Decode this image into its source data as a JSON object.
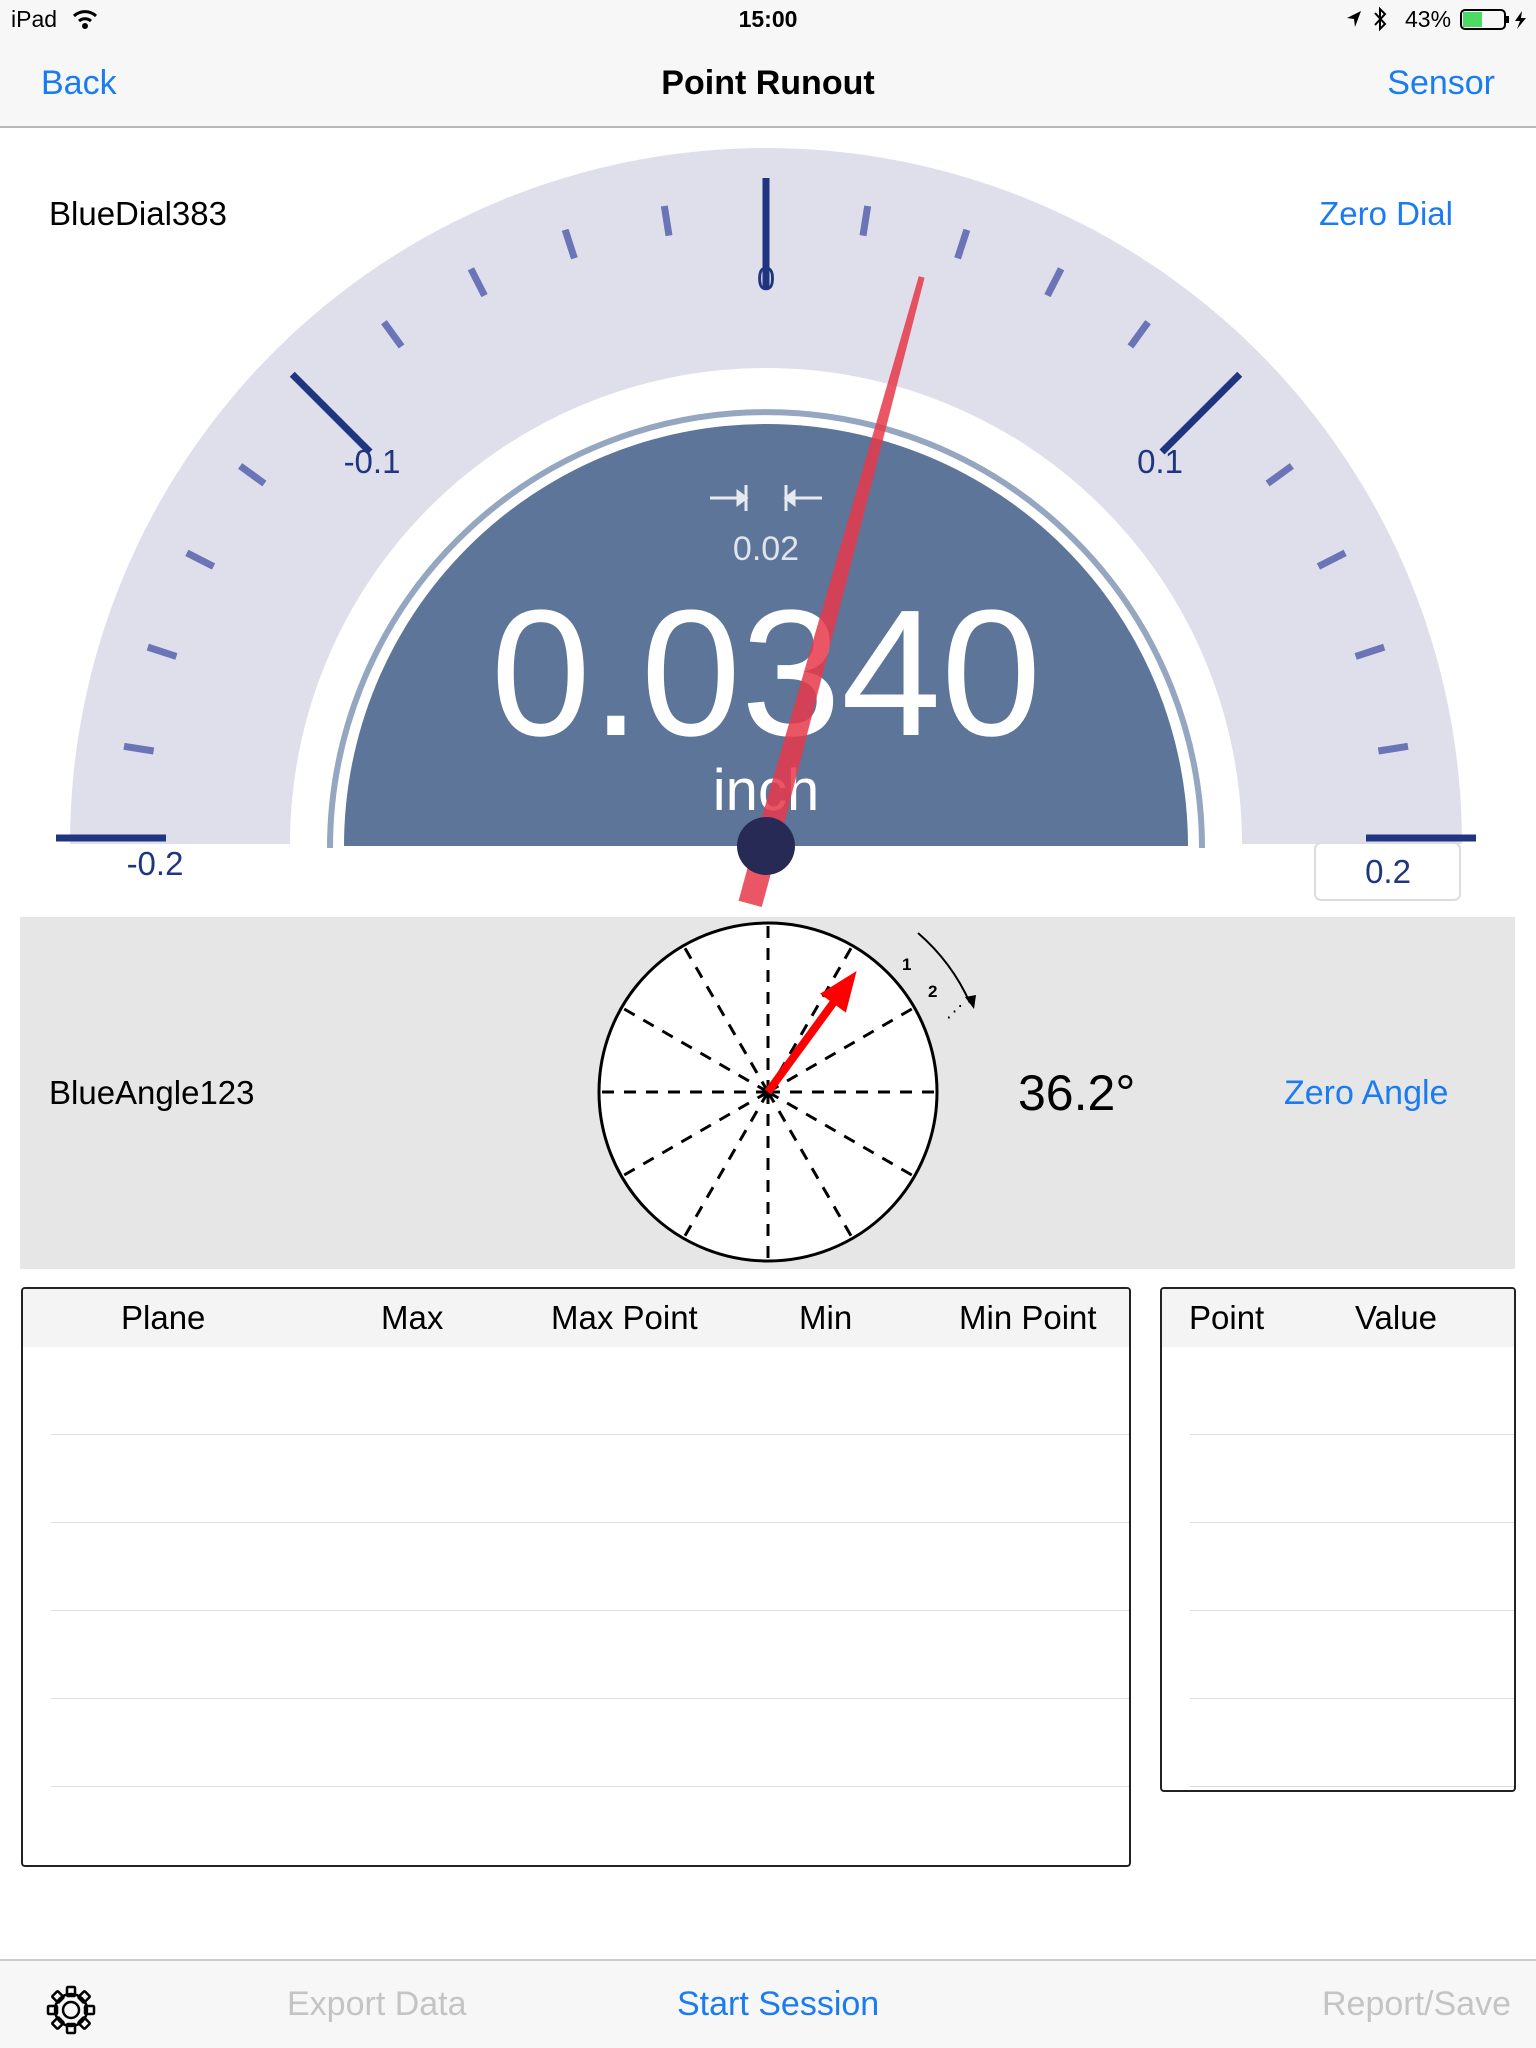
{
  "status_bar": {
    "device": "iPad",
    "time": "15:00",
    "battery": "43%",
    "battery_level": 0.43,
    "icons": [
      "wifi-icon",
      "location-arrow-icon",
      "bluetooth-icon",
      "battery-icon",
      "charging-bolt-icon"
    ]
  },
  "nav": {
    "back": "Back",
    "title": "Point Runout",
    "sensor": "Sensor"
  },
  "dial": {
    "sensor_name": "BlueDial383",
    "zero_label": "Zero Dial",
    "reading": "0.0340",
    "unit": "inch",
    "reading_value": 0.034,
    "tolerance": "0.02",
    "tick_labels": {
      "m02": "-0.2",
      "m01": "-0.1",
      "zero": "0",
      "p01": "0.1",
      "p02": "0.2"
    },
    "range": [
      -0.2,
      0.2
    ],
    "colors": {
      "face": "#5d7598",
      "band": "#dfdfec",
      "needle": "#e8384a",
      "ticks": "#6a74b6",
      "major": "#1f3580"
    }
  },
  "angle": {
    "sensor_name": "BlueAngle123",
    "value_text": "36.2°",
    "angle_value": 36.2,
    "zero_label": "Zero Angle",
    "seq_labels": [
      "1",
      "2"
    ]
  },
  "plane_table": {
    "headers": [
      "Plane",
      "Max",
      "Max Point",
      "Min",
      "Min Point"
    ],
    "rows": []
  },
  "point_table": {
    "headers": [
      "Point",
      "Value"
    ],
    "rows": []
  },
  "toolbar": {
    "export": "Export Data",
    "start": "Start Session",
    "report": "Report/Save"
  }
}
